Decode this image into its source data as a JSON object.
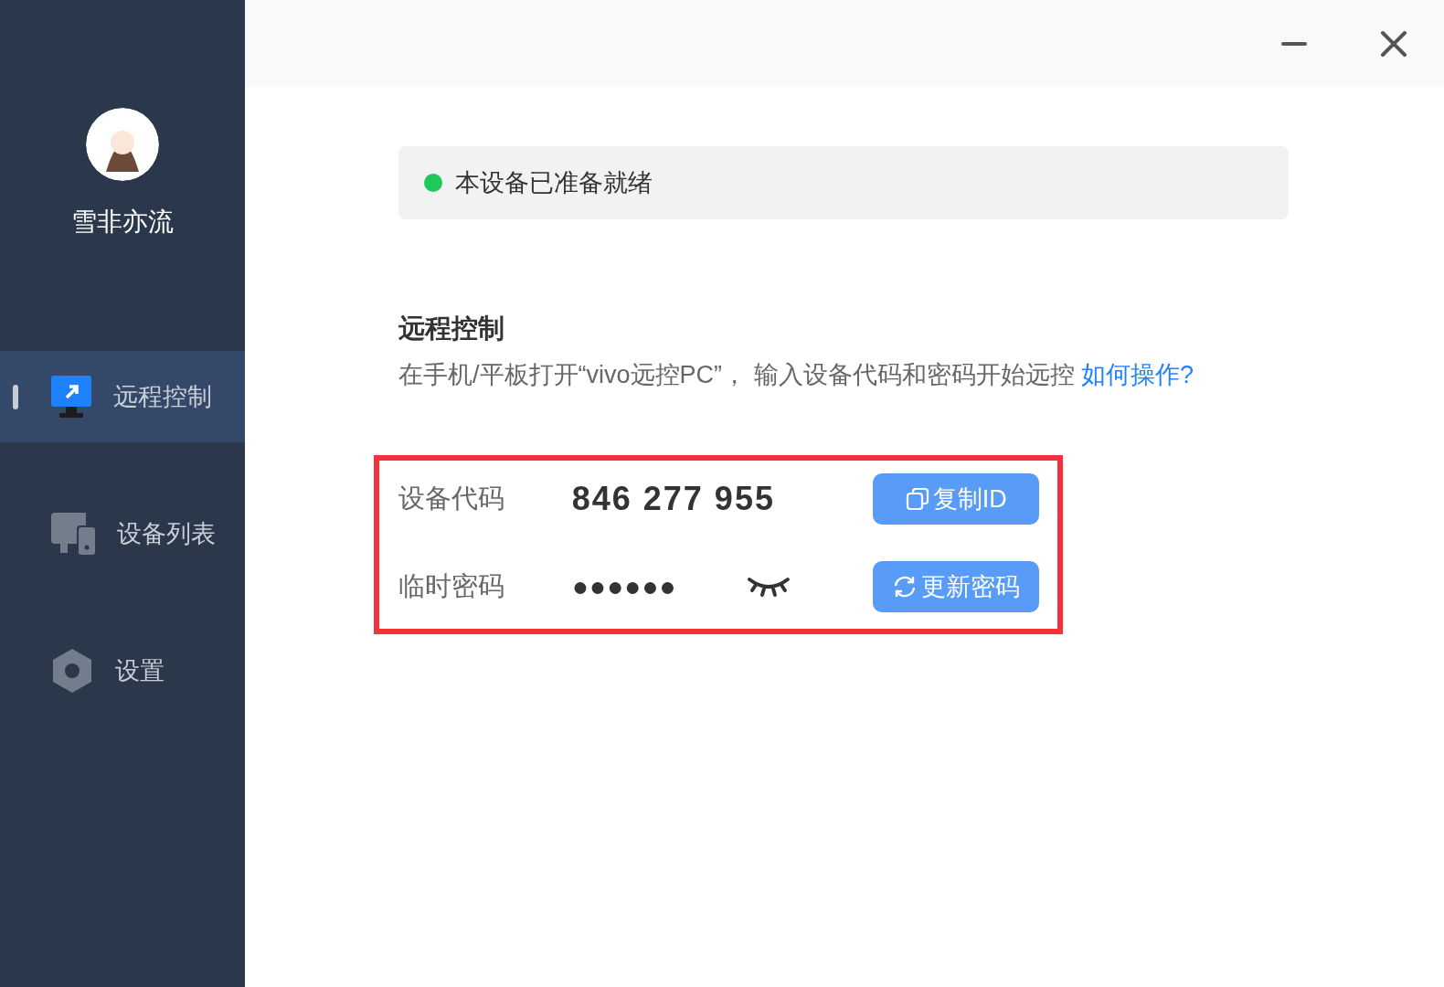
{
  "user": {
    "name": "雪非亦流"
  },
  "nav": [
    {
      "label": "远程控制",
      "kind": "monitor",
      "selected": true
    },
    {
      "label": "设备列表",
      "kind": "devices",
      "selected": false
    },
    {
      "label": "设置",
      "kind": "gear",
      "selected": false
    }
  ],
  "status": {
    "text": "本设备已准备就绪"
  },
  "section": {
    "title": "远程控制",
    "description": "在手机/平板打开“vivo远控PC”， 输入设备代码和密码开始远控",
    "link": "如何操作?"
  },
  "credentials": [
    {
      "label": "设备代码",
      "value": "846 277 955",
      "kind": "code",
      "button": "复制ID"
    },
    {
      "label": "临时密码",
      "value": "●●●●●●",
      "kind": "password",
      "button": "更新密码"
    }
  ]
}
